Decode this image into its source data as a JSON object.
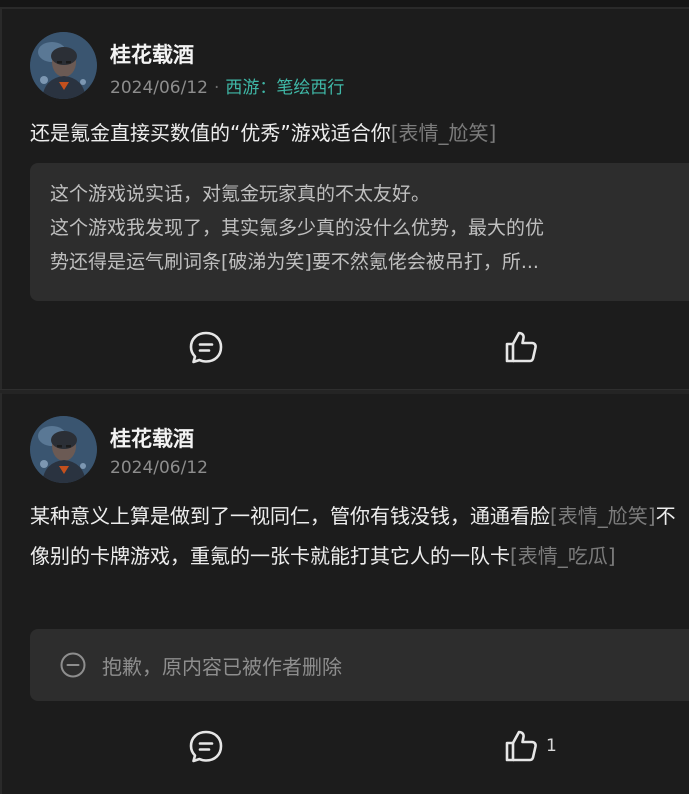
{
  "posts": [
    {
      "username": "桂花载酒",
      "date": "2024/06/12",
      "separator": "·",
      "topic": "西游：笔绘西行",
      "content_text": "还是氪金直接买数值的“优秀”游戏适合你",
      "content_emote": "[表情_尬笑]",
      "quote_lines": [
        "这个游戏说实话，对氪金玩家真的不太友好。",
        "这个游戏我发现了，其实氪多少真的没什么优势，最大的优",
        "势还得是运气刷词条[破涕为笑]要不然氪佬会被吊打，所..."
      ],
      "actions": {
        "comment_icon": "comment-icon",
        "like_icon": "thumbs-up-icon",
        "like_count": ""
      }
    },
    {
      "username": "桂花载酒",
      "date": "2024/06/12",
      "content_text_1": "某种意义上算是做到了一视同仁，管你有钱没钱，通通看脸",
      "content_emote_1": "[表情_尬笑]",
      "content_text_2": "不像别的卡牌游戏，重氪的一张卡就能打其它人的一队卡",
      "content_emote_2": "[表情_吃瓜]",
      "deleted_notice": "抱歉，原内容已被作者删除",
      "actions": {
        "comment_icon": "comment-icon",
        "like_icon": "thumbs-up-icon",
        "like_count": "1"
      }
    }
  ],
  "colors": {
    "background": "#1c1c1c",
    "card_inner": "#2d2d2d",
    "topic": "#3fb8a7",
    "muted": "#8d8d8d",
    "emote": "#7b7b7b"
  }
}
